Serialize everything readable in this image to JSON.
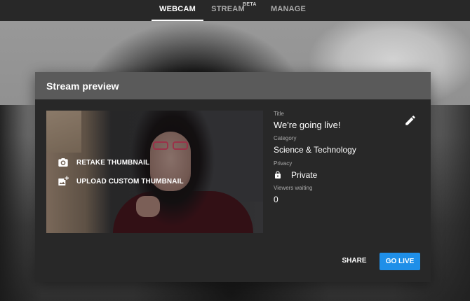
{
  "tabs": [
    {
      "label": "WEBCAM",
      "active": true
    },
    {
      "label": "STREAM",
      "badge": "BETA",
      "active": false
    },
    {
      "label": "MANAGE",
      "active": false
    }
  ],
  "modal": {
    "title": "Stream preview",
    "thumbnail_actions": [
      {
        "label": "RETAKE THUMBNAIL",
        "icon": "camera-icon"
      },
      {
        "label": "UPLOAD CUSTOM THUMBNAIL",
        "icon": "add-photo-icon"
      }
    ],
    "info": {
      "title_label": "Title",
      "title_value": "We're going live!",
      "category_label": "Category",
      "category_value": "Science & Technology",
      "privacy_label": "Privacy",
      "privacy_value": "Private",
      "privacy_icon": "lock-icon",
      "viewers_label": "Viewers waiting",
      "viewers_value": "0",
      "edit_icon": "pencil-icon"
    },
    "buttons": {
      "share": "SHARE",
      "go_live": "GO LIVE"
    }
  },
  "colors": {
    "accent": "#1f8fe8",
    "modal_bg": "#282828",
    "modal_header_bg": "#5a5a5a",
    "topbar_bg": "#282828"
  }
}
